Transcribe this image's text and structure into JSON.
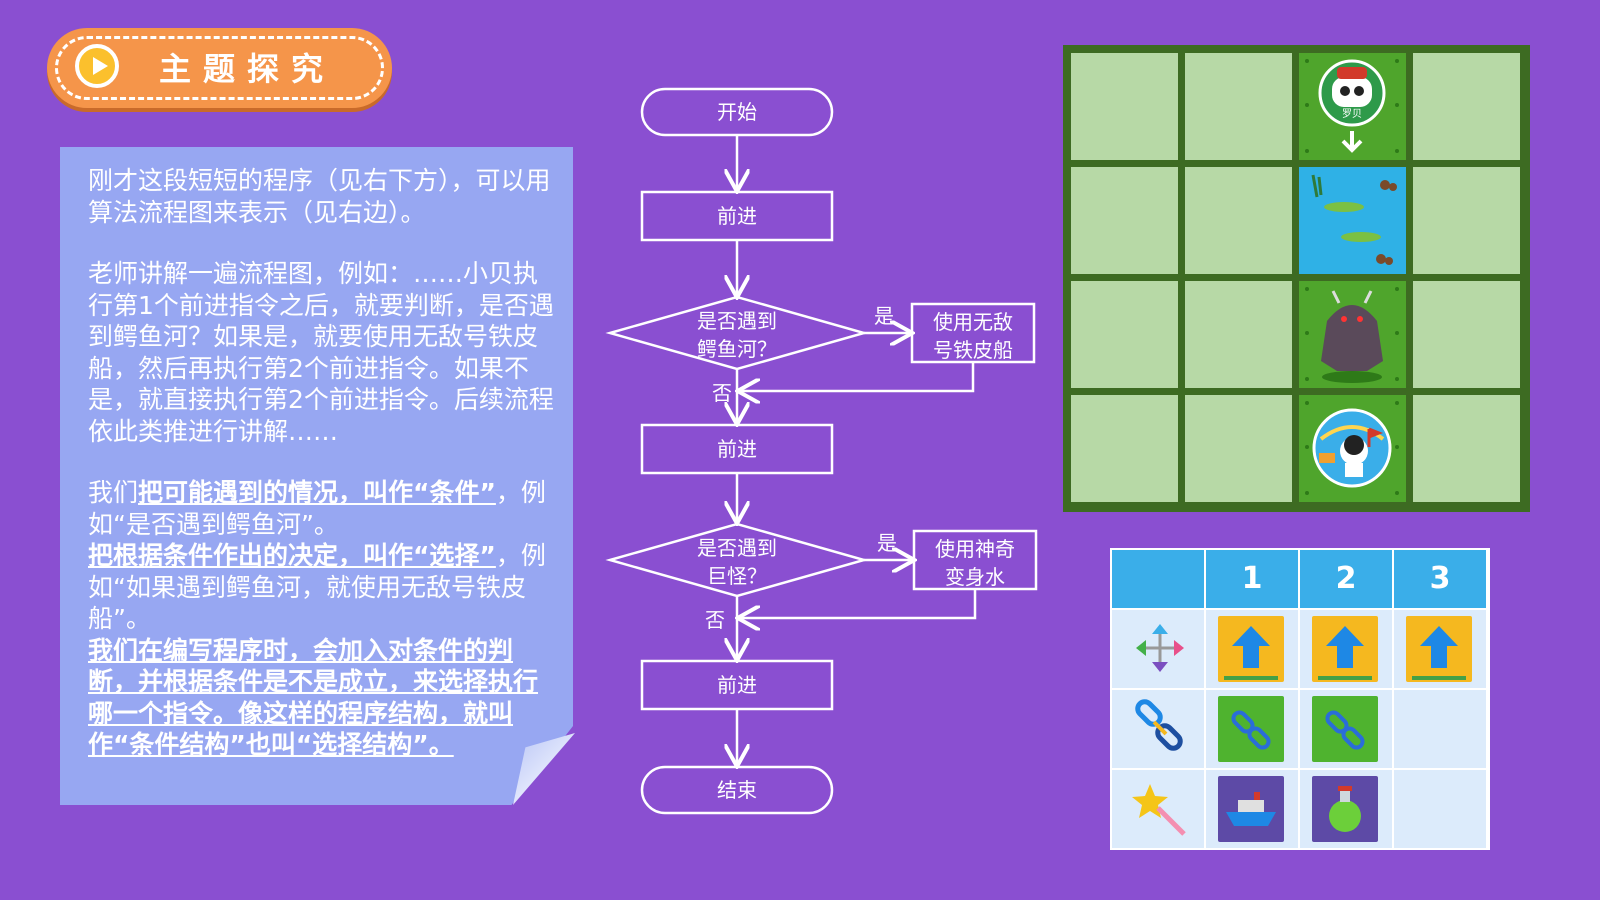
{
  "header": {
    "title": "主题探究"
  },
  "note": {
    "para1": "刚才这段短短的程序（见右下方），可以用算法流程图来表示（见右边）。",
    "para2": "老师讲解一遍流程图，例如：……小贝执行第1个前进指令之后，就要判断，是否遇到鳄鱼河？如果是，就要使用无敌号铁皮船，然后再执行第2个前进指令。如果不是，就直接执行第2个前进指令。后续流程依此类推进行讲解……",
    "p3_a": "我们",
    "p3_b": "把可能遇到的情况，叫作“条件”",
    "p3_c": "，例如“是否遇到鳄鱼河”。",
    "p4_b": "把根据条件作出的决定，叫作“选择”",
    "p4_c": "，例如“如果遇到鳄鱼河，就使用无敌号铁皮船”。",
    "p5": "我们在编写程序时，会加入对条件的判断，并根据条件是不是成立，来选择执行哪一个指令。像这样的程序结构，就叫作“条件结构”也叫“选择结构”。"
  },
  "flowchart": {
    "start": "开始",
    "step1": "前进",
    "decision1_line1": "是否遇到",
    "decision1_line2": "鳄鱼河？",
    "yes1": "是",
    "action1_line1": "使用无敌",
    "action1_line2": "号铁皮船",
    "no1": "否",
    "step2": "前进",
    "decision2_line1": "是否遇到",
    "decision2_line2": "巨怪？",
    "yes2": "是",
    "action2_line1": "使用神奇",
    "action2_line2": "变身水",
    "no2": "否",
    "step3": "前进",
    "end": "结束"
  },
  "map": {
    "rows": 4,
    "cols": 4,
    "path_column": 3,
    "path_cells": [
      "robot-start",
      "crocodile-river",
      "monster",
      "goal"
    ],
    "robot_label": "罗贝"
  },
  "command_table": {
    "headers": [
      "",
      "1",
      "2",
      "3"
    ],
    "rows": [
      {
        "icon": "move-arrows-icon",
        "cells": [
          "up-arrow",
          "up-arrow",
          "up-arrow"
        ]
      },
      {
        "icon": "chain-link-icon",
        "cells": [
          "link",
          "link",
          ""
        ]
      },
      {
        "icon": "magic-star-icon",
        "cells": [
          "boat",
          "potion",
          ""
        ]
      }
    ]
  },
  "colors": {
    "background": "#8a4fd1",
    "badge": "#f5954a",
    "note": "#97a7f2",
    "grid_dark": "#3d6b22",
    "grid_light": "#b7d9a6",
    "table_header": "#3aaee9"
  }
}
